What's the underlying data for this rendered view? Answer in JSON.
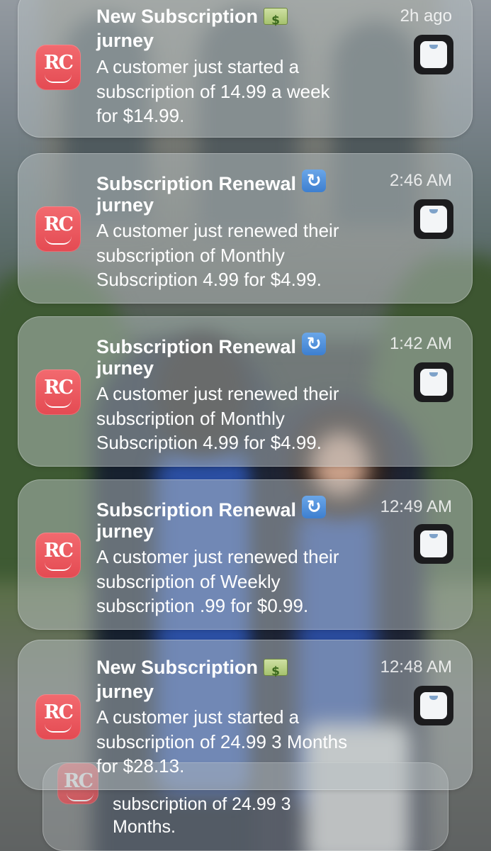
{
  "notifications": [
    {
      "title": "New Subscription",
      "emoji": "money-icon",
      "time": "2h ago",
      "app_name": "jurney",
      "body_lines": [
        "A customer just started a",
        "subscription of 14.99 a week",
        "for $14.99."
      ]
    },
    {
      "title": "Subscription Renewal",
      "emoji": "renew-icon",
      "time": "2:46 AM",
      "app_name": "jurney",
      "body_lines": [
        "A customer just renewed their",
        "subscription of Monthly",
        "Subscription 4.99 for $4.99."
      ]
    },
    {
      "title": "Subscription Renewal",
      "emoji": "renew-icon",
      "time": "1:42 AM",
      "app_name": "jurney",
      "body_lines": [
        "A customer just renewed their",
        "subscription of Monthly",
        "Subscription 4.99 for $4.99."
      ]
    },
    {
      "title": "Subscription Renewal",
      "emoji": "renew-icon",
      "time": "12:49 AM",
      "app_name": "jurney",
      "body_lines": [
        "A customer just renewed their",
        "subscription of Weekly",
        "subscription .99 for $0.99."
      ]
    },
    {
      "title": "New Subscription",
      "emoji": "money-icon",
      "time": "12:48 AM",
      "app_name": "jurney",
      "body_lines": [
        "A customer just started a",
        "subscription of 24.99 3 Months",
        "for $28.13."
      ]
    }
  ],
  "stacked_notification": {
    "body_lines": [
      "subscription of 24.99 3",
      "Months."
    ]
  },
  "app_icon_text": "RC",
  "colors": {
    "app_icon": "#e9555c",
    "card_background": "rgba(190,198,200,0.48)",
    "text": "#ffffff"
  }
}
